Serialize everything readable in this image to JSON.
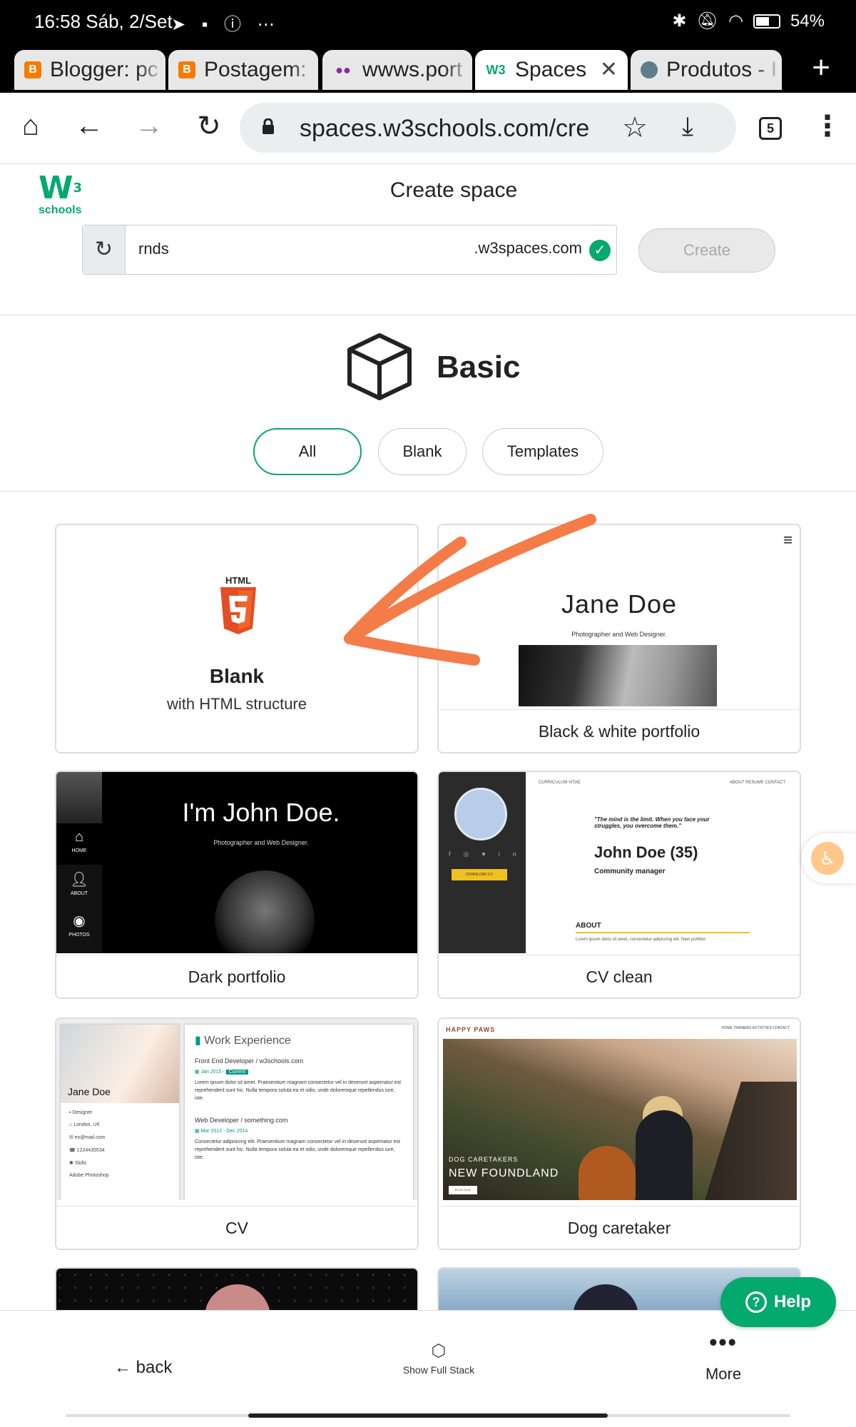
{
  "status_bar": {
    "time": "16:58 Sáb, 2/Set",
    "battery": "54%"
  },
  "tabs": [
    {
      "title": "Blogger: pc",
      "favicon_color": "#f57c00",
      "favicon": "B"
    },
    {
      "title": "Postagem:",
      "favicon_color": "#f57c00",
      "favicon": "B"
    },
    {
      "title": "wwws.port",
      "favicon_color": "#7b1fa2",
      "favicon": "●●"
    },
    {
      "title": "Spaces",
      "favicon_color": "#04aa6d",
      "favicon": "W3",
      "active": true
    },
    {
      "title": "Produtos - I",
      "favicon_color": "#607d8b",
      "favicon": "◍"
    }
  ],
  "toolbar": {
    "url": "spaces.w3schools.com/cre",
    "tab_count": "5"
  },
  "header": {
    "logo_text": "schools",
    "logo_mark": "W",
    "logo_sup": "3",
    "title": "Create space"
  },
  "address": {
    "name": "rnds",
    "domain": ".w3spaces.com",
    "create_label": "Create"
  },
  "section": {
    "title": "Basic"
  },
  "filters": [
    {
      "label": "All",
      "active": true
    },
    {
      "label": "Blank"
    },
    {
      "label": "Templates"
    }
  ],
  "cards": {
    "blank": {
      "html5_label": "HTML",
      "title": "Blank",
      "subtitle": "with HTML structure"
    },
    "bw": {
      "name": "Jane Doe",
      "tagline": "Photographer and Web Designer.",
      "caption": "Black & white portfolio"
    },
    "dark": {
      "headline": "I'm John Doe.",
      "tagline": "Photographer and Web Designer.",
      "nav": [
        "HOME",
        "ABOUT",
        "PHOTOS"
      ],
      "caption": "Dark portfolio"
    },
    "cvclean": {
      "top": "CURRICULUM VITAE",
      "nav": "ABOUT   RESUME   CONTACT",
      "quote": "\"The mind is the limit. When you face your struggles, you overcome them.\"",
      "name": "John Doe (35)",
      "role": "Community manager",
      "about": "ABOUT",
      "about_text": "Lorem ipsum dolor sit amet, consectetur adipiscing elit. Nam porttitor",
      "download": "DOWNLOAD CV",
      "caption": "CV clean"
    },
    "cv": {
      "name": "Jane Doe",
      "lines": [
        "Designer",
        "London, UK",
        "ex@mail.com",
        "1224435534"
      ],
      "skills": "Skills",
      "skill1": "Adobe Photoshop",
      "heading": "Work Experience",
      "job1": "Front End Developer / w3schools.com",
      "job1_date": "Jan 2015 -",
      "job1_current": "Current",
      "job1_text": "Lorem ipsum dolor sit amet. Praesentium magnam consectetur vel in deserunt aspernatur est reprehenderit sunt hic. Nulla tempora soluta ea et odio, unde doloremque repellendus iure, iste.",
      "job2": "Web Developer / something.com",
      "job2_date": "Mar 2012 - Dec 2014",
      "job2_text": "Consectetur adipisicing elit. Praesentium magnam consectetur vel in deserunt aspernatur est reprehenderit sunt hic. Nulla tempora soluta ea et odio, unde doloremque repellendus iure, iste.",
      "caption": "CV"
    },
    "dog": {
      "brand": "HAPPY PAWS",
      "nav": "HOME   TRAINERS   ACTIVITIES   CONTACT",
      "kicker": "DOG CARETAKERS",
      "headline": "NEW FOUNDLAND",
      "book": "BOOK NOW",
      "caption": "Dog caretaker"
    }
  },
  "help": {
    "label": "Help"
  },
  "bottom_bar": {
    "back": "back",
    "stack": "Show Full Stack",
    "more": "More"
  },
  "colors": {
    "brand_green": "#04aa6d",
    "annotation_arrow": "#f47c48"
  }
}
